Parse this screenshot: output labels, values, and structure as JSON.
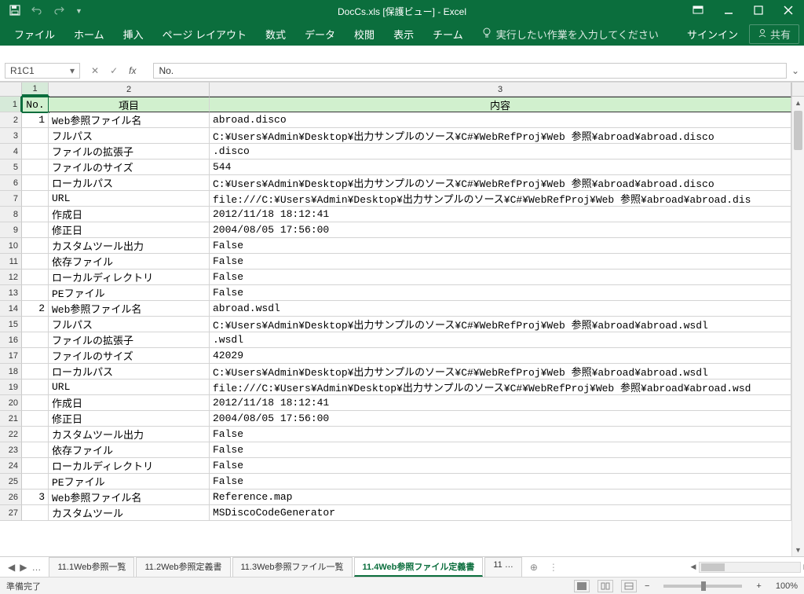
{
  "title": "DocCs.xls [保護ビュー] - Excel",
  "ribbon": {
    "tabs": [
      "ファイル",
      "ホーム",
      "挿入",
      "ページ レイアウト",
      "数式",
      "データ",
      "校閲",
      "表示",
      "チーム"
    ],
    "tellMe": "実行したい作業を入力してください",
    "signIn": "サインイン",
    "share": "共有"
  },
  "nameBox": "R1C1",
  "formula": "No.",
  "columns": [
    "1",
    "2",
    "3"
  ],
  "headerRow": {
    "c1": "No.",
    "c2": "項目",
    "c3": "内容"
  },
  "rows": [
    {
      "n": "1",
      "no": "1",
      "k": "Web参照ファイル名",
      "v": "abroad.disco"
    },
    {
      "n": "2",
      "no": "",
      "k": "フルパス",
      "v": "C:¥Users¥Admin¥Desktop¥出力サンプルのソース¥C#¥WebRefProj¥Web 参照¥abroad¥abroad.disco"
    },
    {
      "n": "3",
      "no": "",
      "k": "ファイルの拡張子",
      "v": ".disco"
    },
    {
      "n": "4",
      "no": "",
      "k": "ファイルのサイズ",
      "v": "544"
    },
    {
      "n": "5",
      "no": "",
      "k": "ローカルパス",
      "v": "C:¥Users¥Admin¥Desktop¥出力サンプルのソース¥C#¥WebRefProj¥Web 参照¥abroad¥abroad.disco"
    },
    {
      "n": "6",
      "no": "",
      "k": "URL",
      "v": "file:///C:¥Users¥Admin¥Desktop¥出力サンプルのソース¥C#¥WebRefProj¥Web 参照¥abroad¥abroad.dis"
    },
    {
      "n": "7",
      "no": "",
      "k": "作成日",
      "v": "2012/11/18 18:12:41"
    },
    {
      "n": "8",
      "no": "",
      "k": "修正日",
      "v": "2004/08/05 17:56:00"
    },
    {
      "n": "9",
      "no": "",
      "k": "カスタムツール出力",
      "v": "False"
    },
    {
      "n": "10",
      "no": "",
      "k": "依存ファイル",
      "v": "False"
    },
    {
      "n": "11",
      "no": "",
      "k": "ローカルディレクトリ",
      "v": "False"
    },
    {
      "n": "12",
      "no": "",
      "k": "PEファイル",
      "v": "False"
    },
    {
      "n": "13",
      "no": "2",
      "k": "Web参照ファイル名",
      "v": "abroad.wsdl"
    },
    {
      "n": "14",
      "no": "",
      "k": "フルパス",
      "v": "C:¥Users¥Admin¥Desktop¥出力サンプルのソース¥C#¥WebRefProj¥Web 参照¥abroad¥abroad.wsdl"
    },
    {
      "n": "15",
      "no": "",
      "k": "ファイルの拡張子",
      "v": ".wsdl"
    },
    {
      "n": "16",
      "no": "",
      "k": "ファイルのサイズ",
      "v": "42029"
    },
    {
      "n": "17",
      "no": "",
      "k": "ローカルパス",
      "v": "C:¥Users¥Admin¥Desktop¥出力サンプルのソース¥C#¥WebRefProj¥Web 参照¥abroad¥abroad.wsdl"
    },
    {
      "n": "18",
      "no": "",
      "k": "URL",
      "v": "file:///C:¥Users¥Admin¥Desktop¥出力サンプルのソース¥C#¥WebRefProj¥Web 参照¥abroad¥abroad.wsd"
    },
    {
      "n": "19",
      "no": "",
      "k": "作成日",
      "v": "2012/11/18 18:12:41"
    },
    {
      "n": "20",
      "no": "",
      "k": "修正日",
      "v": "2004/08/05 17:56:00"
    },
    {
      "n": "21",
      "no": "",
      "k": "カスタムツール出力",
      "v": "False"
    },
    {
      "n": "22",
      "no": "",
      "k": "依存ファイル",
      "v": "False"
    },
    {
      "n": "23",
      "no": "",
      "k": "ローカルディレクトリ",
      "v": "False"
    },
    {
      "n": "24",
      "no": "",
      "k": "PEファイル",
      "v": "False"
    },
    {
      "n": "25",
      "no": "3",
      "k": "Web参照ファイル名",
      "v": "Reference.map"
    },
    {
      "n": "26",
      "no": "",
      "k": "カスタムツール",
      "v": "MSDiscoCodeGenerator"
    }
  ],
  "sheets": {
    "ellipsis": "…",
    "tabs": [
      {
        "label": "11.1Web参照一覧",
        "active": false
      },
      {
        "label": "11.2Web参照定義書",
        "active": false
      },
      {
        "label": "11.3Web参照ファイル一覧",
        "active": false
      },
      {
        "label": "11.4Web参照ファイル定義書",
        "active": true
      },
      {
        "label": "11 …",
        "active": false
      }
    ]
  },
  "status": {
    "ready": "準備完了",
    "zoom": "100%"
  }
}
